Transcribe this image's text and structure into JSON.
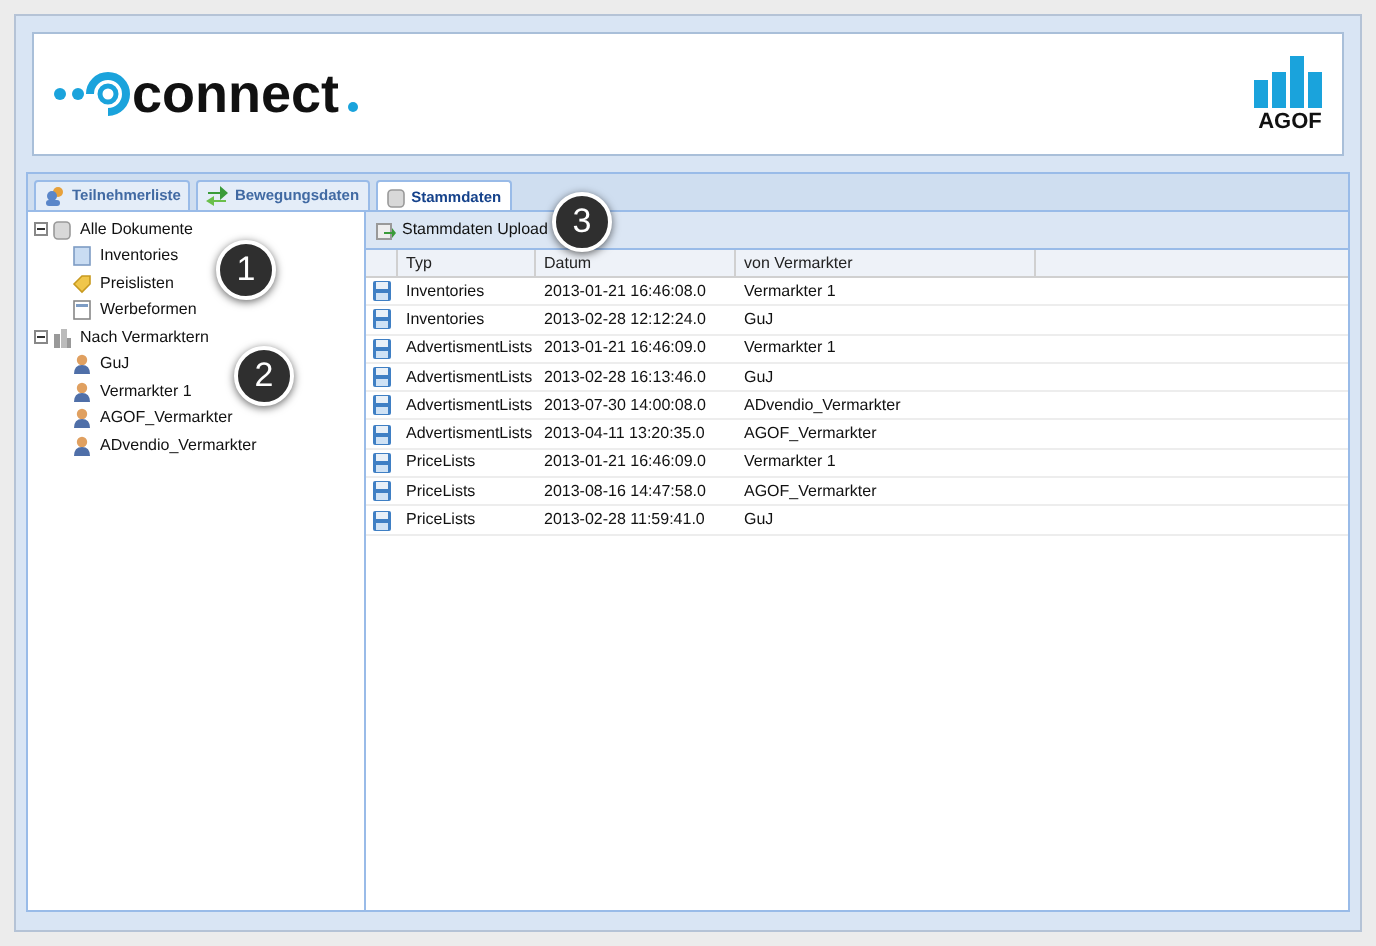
{
  "header": {
    "logo_text": "connect",
    "badge_text": "AGOF"
  },
  "tabs": [
    {
      "label": "Teilnehmerliste",
      "selected": false,
      "kind": "people"
    },
    {
      "label": "Bewegungsdaten",
      "selected": false,
      "kind": "arrows"
    },
    {
      "label": "Stammdaten",
      "selected": true,
      "kind": "db"
    }
  ],
  "tree": [
    {
      "label": "Alle Dokumente",
      "expanded": true,
      "kind": "db",
      "children": [
        {
          "label": "Inventories",
          "kind": "doc"
        },
        {
          "label": "Preislisten",
          "kind": "tag"
        },
        {
          "label": "Werbeformen",
          "kind": "form"
        }
      ]
    },
    {
      "label": "Nach Vermarktern",
      "expanded": true,
      "kind": "building",
      "children": [
        {
          "label": "GuJ",
          "kind": "person"
        },
        {
          "label": "Vermarkter 1",
          "kind": "person"
        },
        {
          "label": "AGOF_Vermarkter",
          "kind": "person"
        },
        {
          "label": "ADvendio_Vermarkter",
          "kind": "person"
        }
      ]
    }
  ],
  "toolbar": {
    "upload_button": "Stammdaten Upload"
  },
  "table": {
    "columns": [
      "Typ",
      "Datum",
      "von Vermarkter"
    ],
    "rows": [
      [
        "Inventories",
        "2013-01-21 16:46:08.0",
        "Vermarkter 1"
      ],
      [
        "Inventories",
        "2013-02-28 12:12:24.0",
        "GuJ"
      ],
      [
        "AdvertismentLists",
        "2013-01-21 16:46:09.0",
        "Vermarkter 1"
      ],
      [
        "AdvertismentLists",
        "2013-02-28 16:13:46.0",
        "GuJ"
      ],
      [
        "AdvertismentLists",
        "2013-07-30 14:00:08.0",
        "ADvendio_Vermarkter"
      ],
      [
        "AdvertismentLists",
        "2013-04-11 13:20:35.0",
        "AGOF_Vermarkter"
      ],
      [
        "PriceLists",
        "2013-01-21 16:46:09.0",
        "Vermarkter 1"
      ],
      [
        "PriceLists",
        "2013-08-16 14:47:58.0",
        "AGOF_Vermarkter"
      ],
      [
        "PriceLists",
        "2013-02-28 11:59:41.0",
        "GuJ"
      ]
    ]
  },
  "callouts": [
    "1",
    "2",
    "3"
  ]
}
